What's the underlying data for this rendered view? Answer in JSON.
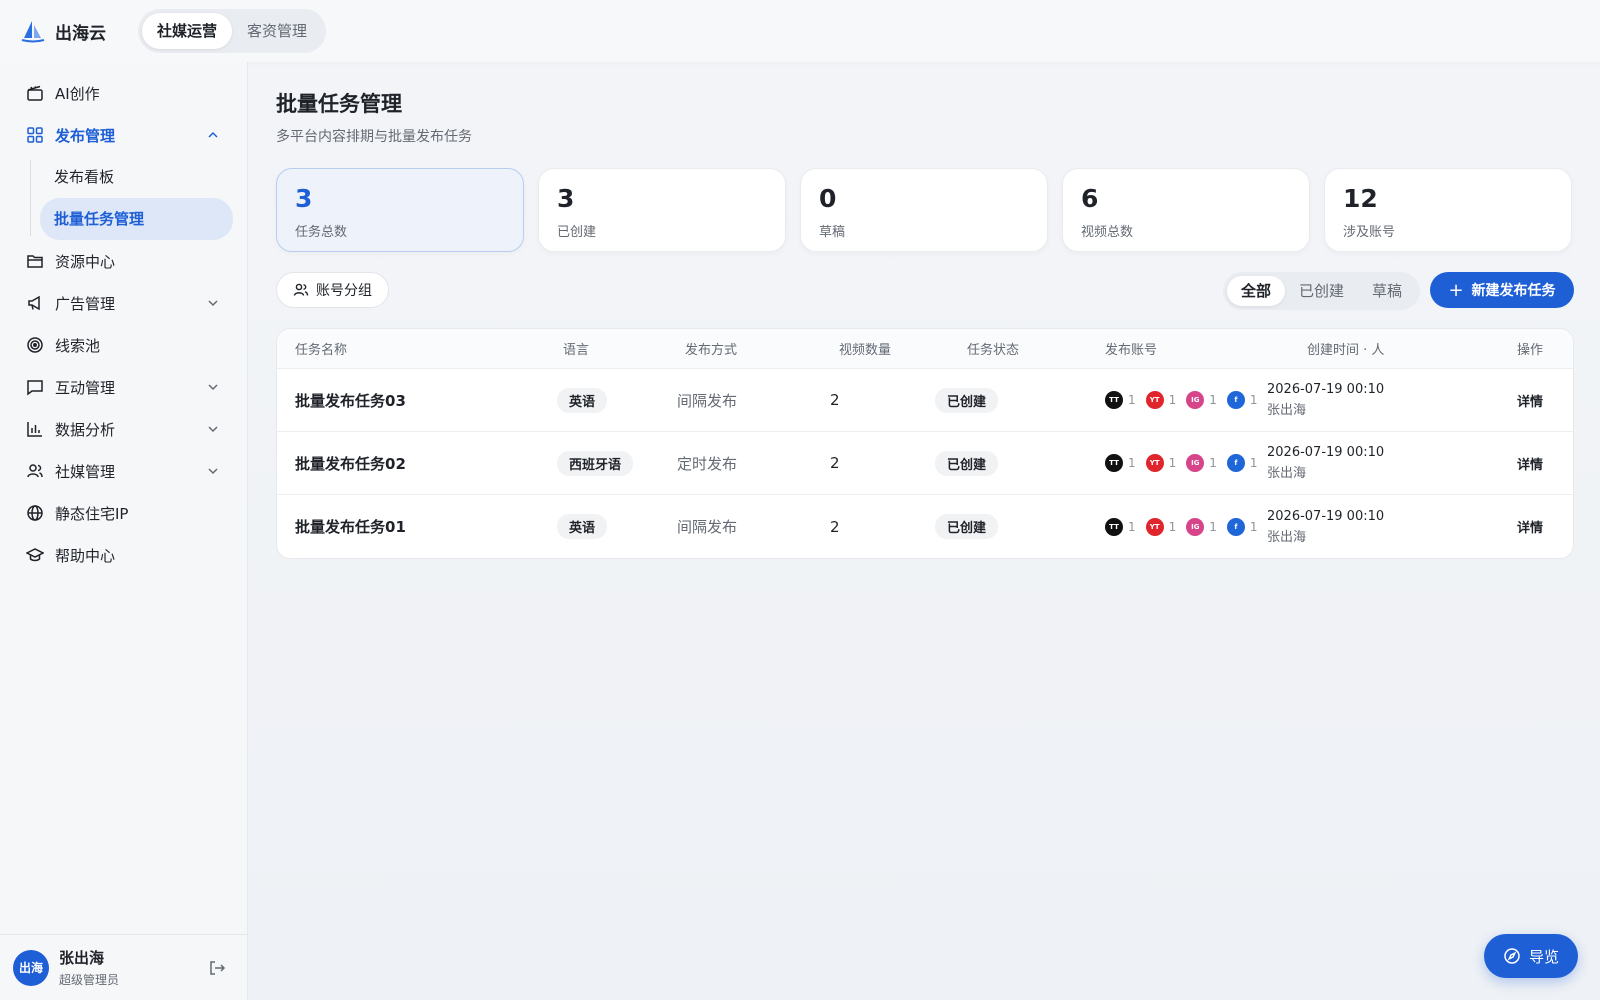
{
  "app": {
    "name": "出海云"
  },
  "top_tabs": [
    {
      "label": "社媒运营",
      "active": true
    },
    {
      "label": "客资管理",
      "active": false
    }
  ],
  "sidebar": {
    "items": [
      {
        "label": "AI创作",
        "icon": "clapperboard-icon"
      },
      {
        "label": "发布管理",
        "icon": "grid-icon",
        "expanded": true
      },
      {
        "label": "资源中心",
        "icon": "folder-icon"
      },
      {
        "label": "广告管理",
        "icon": "megaphone-icon"
      },
      {
        "label": "线索池",
        "icon": "target-icon"
      },
      {
        "label": "互动管理",
        "icon": "chat-icon"
      },
      {
        "label": "数据分析",
        "icon": "bar-chart-icon"
      },
      {
        "label": "社媒管理",
        "icon": "users-icon"
      },
      {
        "label": "静态住宅IP",
        "icon": "globe-icon"
      },
      {
        "label": "帮助中心",
        "icon": "graduation-cap-icon"
      }
    ],
    "sub_items": [
      {
        "label": "发布看板",
        "active": false
      },
      {
        "label": "批量任务管理",
        "active": true
      }
    ]
  },
  "user": {
    "avatar": "出海",
    "name": "张出海",
    "role": "超级管理员"
  },
  "page": {
    "title": "批量任务管理",
    "subtitle": "多平台内容排期与批量发布任务"
  },
  "stats": [
    {
      "value": "3",
      "label": "任务总数",
      "active": true
    },
    {
      "value": "3",
      "label": "已创建"
    },
    {
      "value": "0",
      "label": "草稿"
    },
    {
      "value": "6",
      "label": "视频总数"
    },
    {
      "value": "12",
      "label": "涉及账号"
    }
  ],
  "toolbar": {
    "group_label": "账号分组",
    "filters": [
      {
        "label": "全部",
        "active": true
      },
      {
        "label": "已创建"
      },
      {
        "label": "草稿"
      }
    ],
    "new_label": "新建发布任务",
    "new_icon": "+"
  },
  "table": {
    "headers": {
      "name": "任务名称",
      "lang": "语言",
      "method": "发布方式",
      "count": "视频数量",
      "status": "任务状态",
      "accounts": "发布账号",
      "time": "创建时间 · 人",
      "op": "操作"
    },
    "rows": [
      {
        "name": "批量发布任务03",
        "lang": "英语",
        "method": "间隔发布",
        "count": "2",
        "status": "已创建",
        "time": "2026-07-19 00:10",
        "user": "张出海",
        "op": "详情"
      },
      {
        "name": "批量发布任务02",
        "lang": "西班牙语",
        "method": "定时发布",
        "count": "2",
        "status": "已创建",
        "time": "2026-07-19 00:10",
        "user": "张出海",
        "op": "详情"
      },
      {
        "name": "批量发布任务01",
        "lang": "英语",
        "method": "间隔发布",
        "count": "2",
        "status": "已创建",
        "time": "2026-07-19 00:10",
        "user": "张出海",
        "op": "详情"
      }
    ],
    "platforms": [
      {
        "abbr": "TT",
        "color": "#111111",
        "n": "1"
      },
      {
        "abbr": "YT",
        "color": "#e0262c",
        "n": "1"
      },
      {
        "abbr": "IG",
        "color": "#d6448a",
        "n": "1"
      },
      {
        "abbr": "f",
        "color": "#1f66d8",
        "n": "1"
      }
    ]
  },
  "guide": {
    "label": "导览",
    "icon": "compass-icon"
  },
  "colors": {
    "accent": "#1f5fd6"
  }
}
